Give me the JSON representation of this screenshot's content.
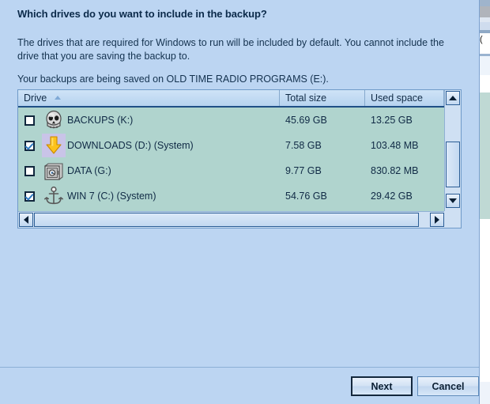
{
  "dialog": {
    "heading": "Which drives do you want to include in the backup?",
    "body_text": "The drives that are required for Windows to run will be included by default. You cannot include the drive that you are saving the backup to.",
    "saved_on_text": "Your backups are being saved on OLD TIME RADIO PROGRAMS (E:).",
    "background_color": "#bcd5f2",
    "list_row_color": "#b0d4ce"
  },
  "list": {
    "columns": [
      {
        "key": "drive",
        "label": "Drive",
        "sorted": "ascending"
      },
      {
        "key": "total",
        "label": "Total size",
        "sorted": "none"
      },
      {
        "key": "used",
        "label": "Used space",
        "sorted": "none"
      }
    ],
    "rows": [
      {
        "checked": false,
        "icon": "skull-icon",
        "icon_highlighted": false,
        "drive": "BACKUPS (K:)",
        "total": "45.69 GB",
        "used": "13.25 GB"
      },
      {
        "checked": true,
        "icon": "down-arrow-icon",
        "icon_highlighted": true,
        "drive": "DOWNLOADS (D:) (System)",
        "total": "7.58 GB",
        "used": "103.48 MB"
      },
      {
        "checked": false,
        "icon": "safe-icon",
        "icon_highlighted": false,
        "drive": "DATA (G:)",
        "total": "9.77 GB",
        "used": "830.82 MB"
      },
      {
        "checked": true,
        "icon": "anchor-icon",
        "icon_highlighted": false,
        "drive": "WIN 7 (C:) (System)",
        "total": "54.76 GB",
        "used": "29.42 GB"
      }
    ],
    "scrollbars": {
      "vertical": {
        "up_icon": "triangle-up-icon",
        "down_icon": "triangle-down-icon"
      },
      "horizontal": {
        "left_icon": "triangle-left-icon",
        "right_icon": "triangle-right-icon"
      }
    }
  },
  "footer": {
    "next_label": "Next",
    "cancel_label": "Cancel"
  }
}
